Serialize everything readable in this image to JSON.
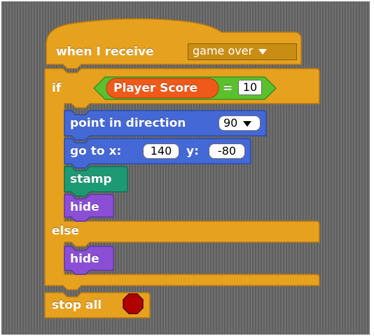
{
  "colors": {
    "background": "#6f6f6f",
    "control": "#e6a11f",
    "control_dark": "#b7790f",
    "motion": "#4468d6",
    "pen": "#1d9a73",
    "looks": "#8b4fd6",
    "operators": "#5ac02e",
    "variables": "#ef5a1a",
    "stop": "#b00000"
  },
  "script": {
    "hat": {
      "label": "when I receive",
      "message": "game over"
    },
    "if_block": {
      "if_label": "if",
      "condition": {
        "variable": "Player Score",
        "operator": "=",
        "value": "10"
      },
      "then": [
        {
          "type": "motion",
          "label": "point in direction",
          "value": "90"
        },
        {
          "type": "motion",
          "label": "go to x:",
          "x": "140",
          "y_label": "y:",
          "y": "-80"
        },
        {
          "type": "pen",
          "label": "stamp"
        },
        {
          "type": "looks",
          "label": "hide"
        }
      ],
      "else_label": "else",
      "else": [
        {
          "type": "looks",
          "label": "hide"
        }
      ]
    },
    "final": {
      "label": "stop all",
      "icon": "stop-sign-icon"
    }
  }
}
